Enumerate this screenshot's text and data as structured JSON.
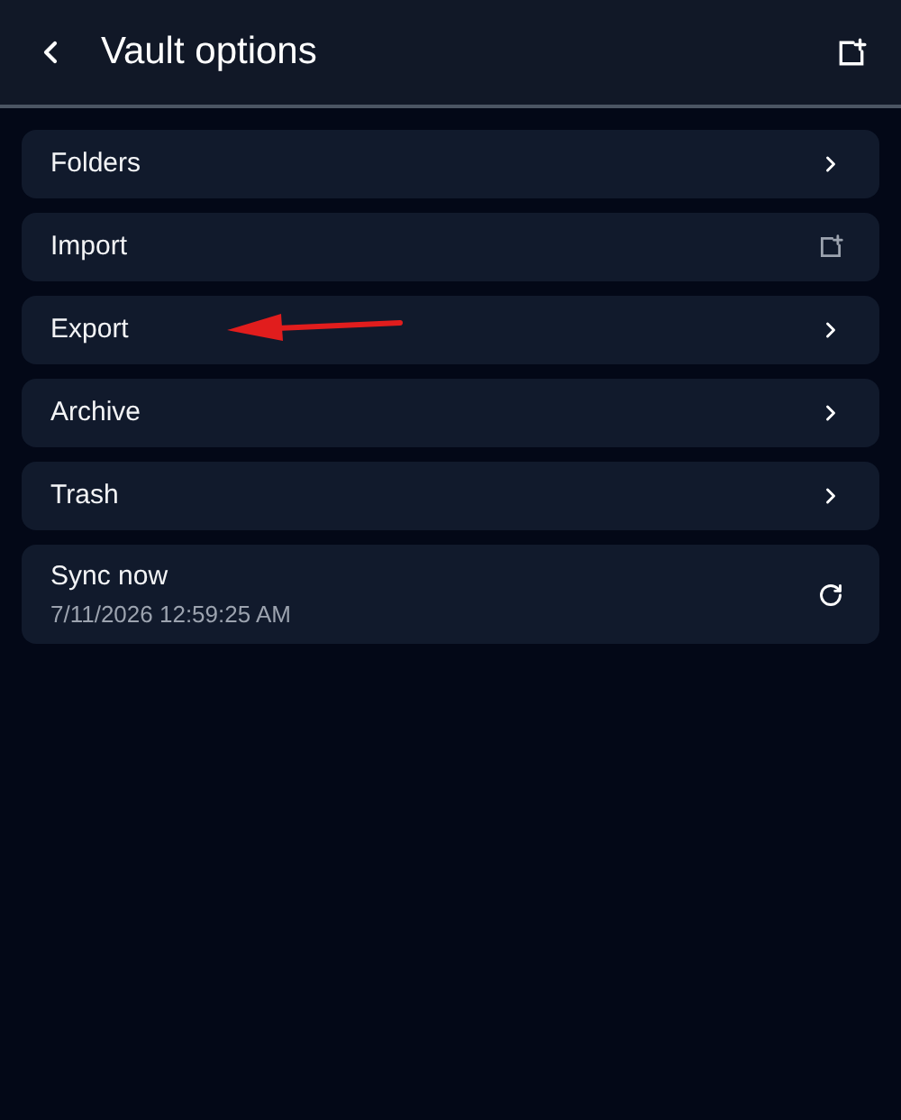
{
  "header": {
    "title": "Vault options"
  },
  "items": [
    {
      "kind": "chevron",
      "label": "Folders"
    },
    {
      "kind": "external",
      "label": "Import"
    },
    {
      "kind": "chevron",
      "label": "Export",
      "annotated": true
    },
    {
      "kind": "chevron",
      "label": "Archive"
    },
    {
      "kind": "chevron",
      "label": "Trash"
    },
    {
      "kind": "sync",
      "label": "Sync now",
      "subtitle": "7/11/2026 12:59:25 AM"
    }
  ]
}
